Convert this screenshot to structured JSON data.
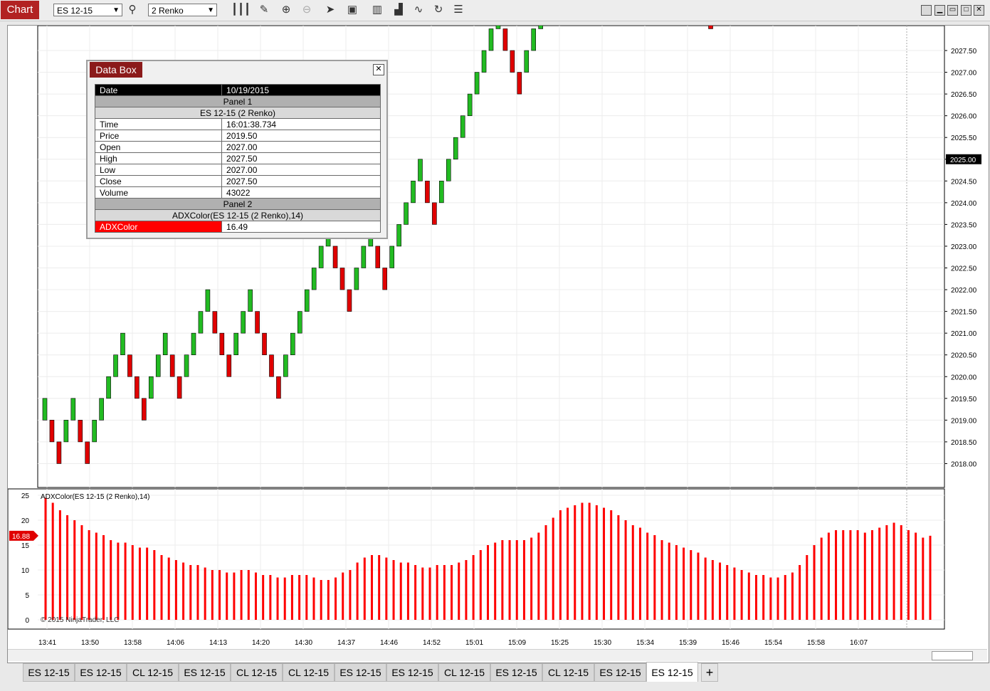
{
  "toolbar": {
    "chart_label": "Chart",
    "instrument": "ES 12-15",
    "bar_type": "2 Renko",
    "icons": [
      "search-icon",
      "bars-type-icon",
      "draw-pencil-icon",
      "zoom-in-icon",
      "zoom-out-icon",
      "pointer-icon",
      "data-box-icon",
      "properties-icon",
      "strategies-icon",
      "indicators-icon",
      "reload-icon",
      "list-icon"
    ],
    "window_buttons": [
      "minimize-all",
      "restore",
      "maximize",
      "close"
    ]
  },
  "price_axis": {
    "labels": [
      "2027.50",
      "2027.00",
      "2026.50",
      "2026.00",
      "2025.50",
      "2025.00",
      "2024.50",
      "2024.00",
      "2023.50",
      "2023.00",
      "2022.50",
      "2022.00",
      "2021.50",
      "2021.00",
      "2020.50",
      "2020.00",
      "2019.50",
      "2019.00",
      "2018.50",
      "2018.00"
    ],
    "current_price": "2025.00"
  },
  "indicator_axis": {
    "labels": [
      "25",
      "20",
      "15",
      "10",
      "5",
      "0"
    ],
    "current_value": "16.88"
  },
  "time_axis": {
    "labels": [
      "13:41",
      "13:50",
      "13:58",
      "14:06",
      "14:13",
      "14:20",
      "14:30",
      "14:37",
      "14:46",
      "14:52",
      "15:01",
      "15:09",
      "15:25",
      "15:30",
      "15:34",
      "15:39",
      "15:46",
      "15:54",
      "15:58",
      "16:07"
    ]
  },
  "indicator_panel": {
    "title": "ADXColor(ES 12-15 (2 Renko),14)",
    "copyright": "© 2015 NinjaTrader, LLC"
  },
  "data_box": {
    "title": "Data Box",
    "date_label": "Date",
    "date_value": "10/19/2015",
    "panel1": "Panel 1",
    "series1": "ES 12-15 (2 Renko)",
    "rows": [
      {
        "label": "Time",
        "value": "16:01:38.734"
      },
      {
        "label": "Price",
        "value": "2019.50"
      },
      {
        "label": "Open",
        "value": "2027.00"
      },
      {
        "label": "High",
        "value": "2027.50"
      },
      {
        "label": "Low",
        "value": "2027.00"
      },
      {
        "label": "Close",
        "value": "2027.50"
      },
      {
        "label": "Volume",
        "value": "43022"
      }
    ],
    "panel2": "Panel 2",
    "series2": "ADXColor(ES 12-15 (2 Renko),14)",
    "indicator_label": "ADXColor",
    "indicator_value": "16.49"
  },
  "tabs": [
    "ES 12-15",
    "ES 12-15",
    "CL 12-15",
    "ES 12-15",
    "CL 12-15",
    "CL 12-15",
    "ES 12-15",
    "ES 12-15",
    "CL 12-15",
    "ES 12-15",
    "CL 12-15",
    "ES 12-15",
    "ES 12-15"
  ],
  "active_tab_index": 12,
  "tab_add": "+",
  "colors": {
    "up": "#22bb22",
    "down": "#e00000",
    "accent": "#b22222",
    "indicator": "#ff0000"
  },
  "chart_data": {
    "type": "bar",
    "renko_brick_size": 0.5,
    "renko_directions": [
      1,
      -1,
      -1,
      1,
      1,
      -1,
      -1,
      1,
      1,
      1,
      1,
      1,
      -1,
      -1,
      -1,
      1,
      1,
      1,
      -1,
      -1,
      1,
      1,
      1,
      1,
      -1,
      -1,
      -1,
      1,
      1,
      1,
      -1,
      -1,
      -1,
      -1,
      1,
      1,
      1,
      1,
      1,
      1,
      1,
      -1,
      -1,
      -1,
      1,
      1,
      1,
      -1,
      -1,
      1,
      1,
      1,
      1,
      1,
      -1,
      -1,
      1,
      1,
      1,
      1,
      1,
      1,
      1,
      1,
      1,
      -1,
      -1,
      -1,
      1,
      1,
      1,
      1,
      1,
      1,
      1,
      1,
      -1,
      -1,
      -1,
      -1,
      1,
      1,
      1,
      -1,
      -1,
      -1,
      1,
      1,
      -1,
      1,
      1,
      -1,
      -1,
      -1,
      -1,
      1,
      1,
      1,
      -1,
      -1,
      1,
      1,
      1,
      -1,
      -1,
      1,
      1,
      1,
      1,
      1,
      1,
      1,
      1,
      1,
      1,
      -1,
      -1,
      -1,
      1,
      1,
      1,
      1,
      -1,
      -1,
      -1,
      -1,
      -1
    ],
    "renko_start_price": 2019.0,
    "adx_values": [
      24.5,
      23.5,
      22,
      21,
      20,
      19,
      18,
      17.5,
      17,
      16,
      15.5,
      15.5,
      15,
      14.5,
      14.5,
      14,
      13,
      12.5,
      12,
      11.5,
      11,
      11,
      10.5,
      10,
      10,
      9.5,
      9.5,
      10,
      10,
      9.5,
      9,
      9,
      8.5,
      8.5,
      9,
      9,
      9,
      8.5,
      8,
      8,
      8.5,
      9.5,
      10,
      11.5,
      12.5,
      13,
      13,
      12.5,
      12,
      11.5,
      11.5,
      11,
      10.5,
      10.5,
      11,
      11,
      11,
      11.5,
      12,
      13,
      14,
      15,
      15.5,
      16,
      16,
      16,
      16,
      16.5,
      17.5,
      19,
      20.5,
      22,
      22.5,
      23,
      23.5,
      23.5,
      23,
      22.5,
      22,
      21,
      20,
      19,
      18.5,
      17.5,
      17,
      16,
      15.5,
      15,
      14.5,
      14,
      13.5,
      12.5,
      12,
      11.5,
      11,
      10.5,
      10,
      9.5,
      9,
      9,
      8.5,
      8.5,
      9,
      9.5,
      11,
      13,
      15,
      16.5,
      17.5,
      18,
      18,
      18,
      18,
      17.5,
      18,
      18.5,
      19,
      19.5,
      19,
      18,
      17.5,
      16.5,
      16.88
    ]
  }
}
